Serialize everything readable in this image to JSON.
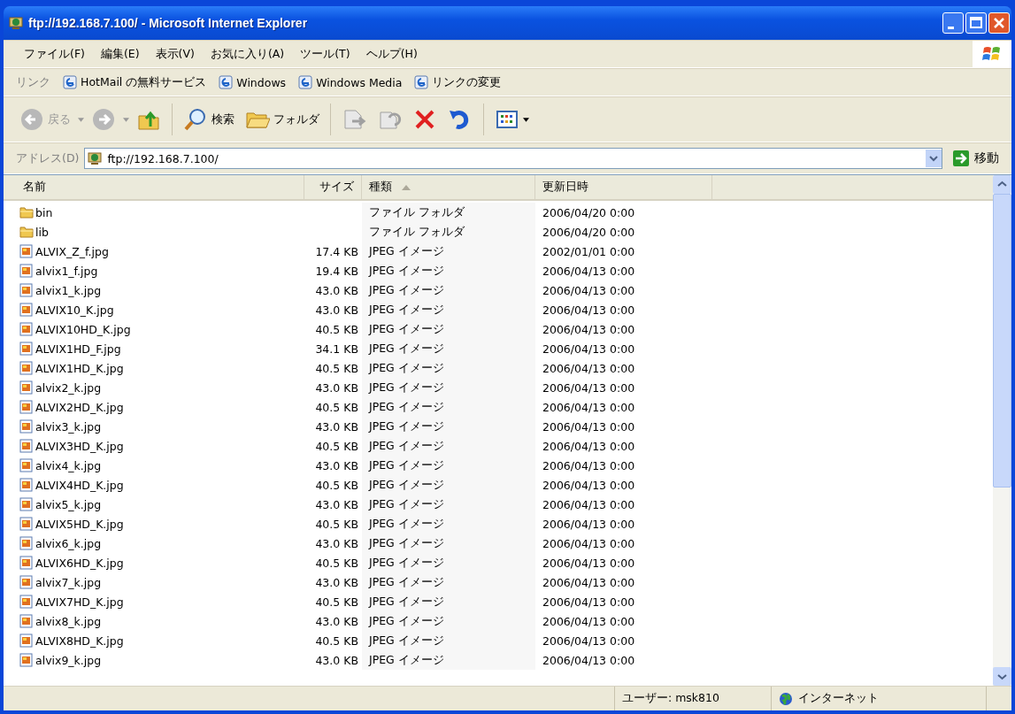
{
  "window": {
    "title": "ftp://192.168.7.100/ - Microsoft Internet Explorer"
  },
  "menu": [
    "ファイル(F)",
    "編集(E)",
    "表示(V)",
    "お気に入り(A)",
    "ツール(T)",
    "ヘルプ(H)"
  ],
  "links": {
    "label": "リンク",
    "items": [
      "HotMail の無料サービス",
      "Windows",
      "Windows Media",
      "リンクの変更"
    ]
  },
  "toolbar": {
    "back": "戻る",
    "search": "検索",
    "folders": "フォルダ"
  },
  "address": {
    "label": "アドレス(D)",
    "value": "ftp://192.168.7.100/",
    "go": "移動"
  },
  "table": {
    "columns": [
      {
        "label": "名前",
        "sorted": false
      },
      {
        "label": "サイズ",
        "sorted": false
      },
      {
        "label": "種類",
        "sorted": true
      },
      {
        "label": "更新日時",
        "sorted": false
      }
    ],
    "rows": [
      {
        "kind": "folder",
        "name": "bin",
        "type": "ファイル フォルダ",
        "date": "2006/04/20 0:00"
      },
      {
        "kind": "folder",
        "name": "lib",
        "type": "ファイル フォルダ",
        "date": "2006/04/20 0:00"
      },
      {
        "kind": "image",
        "name": "ALVIX_Z_f.jpg",
        "size": "17.4 KB",
        "type": "JPEG イメージ",
        "date": "2002/01/01 0:00"
      },
      {
        "kind": "image",
        "name": "alvix1_f.jpg",
        "size": "19.4 KB",
        "type": "JPEG イメージ",
        "date": "2006/04/13 0:00"
      },
      {
        "kind": "image",
        "name": "alvix1_k.jpg",
        "size": "43.0 KB",
        "type": "JPEG イメージ",
        "date": "2006/04/13 0:00"
      },
      {
        "kind": "image",
        "name": "ALVIX10_K.jpg",
        "size": "43.0 KB",
        "type": "JPEG イメージ",
        "date": "2006/04/13 0:00"
      },
      {
        "kind": "image",
        "name": "ALVIX10HD_K.jpg",
        "size": "40.5 KB",
        "type": "JPEG イメージ",
        "date": "2006/04/13 0:00"
      },
      {
        "kind": "image",
        "name": "ALVIX1HD_F.jpg",
        "size": "34.1 KB",
        "type": "JPEG イメージ",
        "date": "2006/04/13 0:00"
      },
      {
        "kind": "image",
        "name": "ALVIX1HD_K.jpg",
        "size": "40.5 KB",
        "type": "JPEG イメージ",
        "date": "2006/04/13 0:00"
      },
      {
        "kind": "image",
        "name": "alvix2_k.jpg",
        "size": "43.0 KB",
        "type": "JPEG イメージ",
        "date": "2006/04/13 0:00"
      },
      {
        "kind": "image",
        "name": "ALVIX2HD_K.jpg",
        "size": "40.5 KB",
        "type": "JPEG イメージ",
        "date": "2006/04/13 0:00"
      },
      {
        "kind": "image",
        "name": "alvix3_k.jpg",
        "size": "43.0 KB",
        "type": "JPEG イメージ",
        "date": "2006/04/13 0:00"
      },
      {
        "kind": "image",
        "name": "ALVIX3HD_K.jpg",
        "size": "40.5 KB",
        "type": "JPEG イメージ",
        "date": "2006/04/13 0:00"
      },
      {
        "kind": "image",
        "name": "alvix4_k.jpg",
        "size": "43.0 KB",
        "type": "JPEG イメージ",
        "date": "2006/04/13 0:00"
      },
      {
        "kind": "image",
        "name": "ALVIX4HD_K.jpg",
        "size": "40.5 KB",
        "type": "JPEG イメージ",
        "date": "2006/04/13 0:00"
      },
      {
        "kind": "image",
        "name": "alvix5_k.jpg",
        "size": "43.0 KB",
        "type": "JPEG イメージ",
        "date": "2006/04/13 0:00"
      },
      {
        "kind": "image",
        "name": "ALVIX5HD_K.jpg",
        "size": "40.5 KB",
        "type": "JPEG イメージ",
        "date": "2006/04/13 0:00"
      },
      {
        "kind": "image",
        "name": "alvix6_k.jpg",
        "size": "43.0 KB",
        "type": "JPEG イメージ",
        "date": "2006/04/13 0:00"
      },
      {
        "kind": "image",
        "name": "ALVIX6HD_K.jpg",
        "size": "40.5 KB",
        "type": "JPEG イメージ",
        "date": "2006/04/13 0:00"
      },
      {
        "kind": "image",
        "name": "alvix7_k.jpg",
        "size": "43.0 KB",
        "type": "JPEG イメージ",
        "date": "2006/04/13 0:00"
      },
      {
        "kind": "image",
        "name": "ALVIX7HD_K.jpg",
        "size": "40.5 KB",
        "type": "JPEG イメージ",
        "date": "2006/04/13 0:00"
      },
      {
        "kind": "image",
        "name": "alvix8_k.jpg",
        "size": "43.0 KB",
        "type": "JPEG イメージ",
        "date": "2006/04/13 0:00"
      },
      {
        "kind": "image",
        "name": "ALVIX8HD_K.jpg",
        "size": "40.5 KB",
        "type": "JPEG イメージ",
        "date": "2006/04/13 0:00"
      },
      {
        "kind": "image",
        "name": "alvix9_k.jpg",
        "size": "43.0 KB",
        "type": "JPEG イメージ",
        "date": "2006/04/13 0:00"
      }
    ]
  },
  "status_bar": {
    "user": "ユーザー: msk810",
    "zone": "インターネット"
  }
}
